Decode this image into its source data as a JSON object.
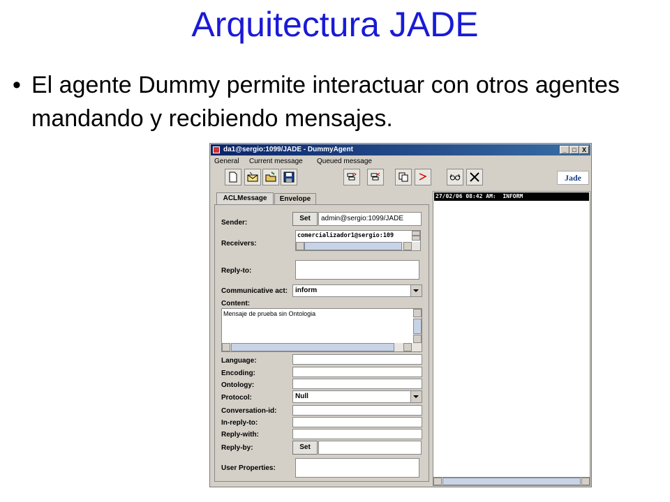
{
  "slide": {
    "title": "Arquitectura JADE",
    "bullet": "El agente Dummy permite interactuar con otros agentes mandando y recibiendo mensajes."
  },
  "window": {
    "title": "da1@sergio:1099/JADE - DummyAgent",
    "minimize_glyph": "_",
    "maximize_glyph": "□",
    "close_glyph": "X",
    "menu": [
      "General",
      "Current message",
      "Queued message"
    ],
    "logo": "Jade"
  },
  "toolbar": {
    "icons": [
      "new-message-icon",
      "open-mail-icon",
      "open-folder-icon",
      "save-icon",
      "send-icon",
      "send-reply-icon",
      "copy-icon",
      "reply-arrow-icon",
      "view-glasses-icon",
      "tools-icon"
    ]
  },
  "tabs": [
    "ACLMessage",
    "Envelope"
  ],
  "form": {
    "sender_label": "Sender:",
    "sender_set": "Set",
    "sender_value": "admin@sergio:1099/JADE",
    "receivers_label": "Receivers:",
    "receivers_value": "comercializador1@sergio:109",
    "reply_to_label": "Reply-to:",
    "communicative_act_label": "Communicative act:",
    "communicative_act_value": "inform",
    "content_label": "Content:",
    "content_value": "Mensaje de prueba sin Ontologia",
    "language_label": "Language:",
    "encoding_label": "Encoding:",
    "ontology_label": "Ontology:",
    "protocol_label": "Protocol:",
    "protocol_value": "Null",
    "conversation_id_label": "Conversation-id:",
    "in_reply_to_label": "In-reply-to:",
    "reply_with_label": "Reply-with:",
    "reply_by_label": "Reply-by:",
    "reply_by_set": "Set",
    "user_properties_label": "User Properties:"
  },
  "log": {
    "entries": [
      "27/02/06 08:42 AM:  INFORM"
    ]
  }
}
